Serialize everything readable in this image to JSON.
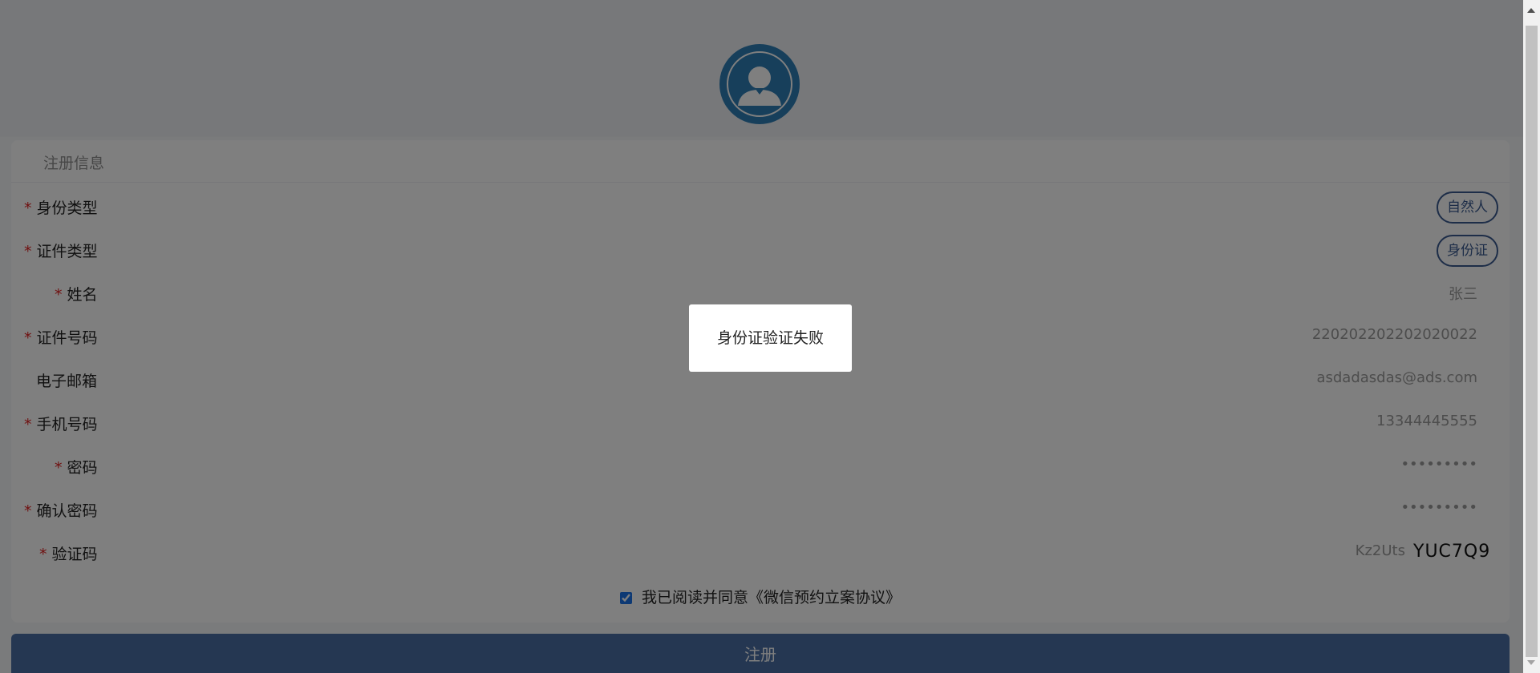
{
  "form": {
    "section_title": "注册信息",
    "fields": [
      {
        "key": "identity_type",
        "label": "身份类型",
        "required": true,
        "value": "自然人",
        "kind": "pill"
      },
      {
        "key": "cert_type",
        "label": "证件类型",
        "required": true,
        "value": "身份证",
        "kind": "pill"
      },
      {
        "key": "name",
        "label": "姓名",
        "required": true,
        "value": "张三",
        "kind": "text"
      },
      {
        "key": "cert_number",
        "label": "证件号码",
        "required": true,
        "value": "220202202202020022",
        "kind": "text"
      },
      {
        "key": "email",
        "label": "电子邮箱",
        "required": false,
        "value": "asdadasdas@ads.com",
        "kind": "text"
      },
      {
        "key": "phone",
        "label": "手机号码",
        "required": true,
        "value": "13344445555",
        "kind": "text"
      },
      {
        "key": "password",
        "label": "密码",
        "required": true,
        "value": "•••••••••",
        "kind": "password"
      },
      {
        "key": "confirm_password",
        "label": "确认密码",
        "required": true,
        "value": "•••••••••",
        "kind": "password"
      },
      {
        "key": "captcha",
        "label": "验证码",
        "required": true,
        "value": "Kz2Uts",
        "captcha_image_text": "YUC7Q9",
        "kind": "captcha"
      }
    ],
    "agreement_text": "我已阅读并同意《微信预约立案协议》",
    "agreement_checked": true,
    "submit_label": "注册"
  },
  "toast": {
    "message": "身份证验证失败"
  },
  "colors": {
    "avatar": "#2f7fb6",
    "primary_button": "#4a6fa5",
    "pill_border": "#3b5b90",
    "required_mark": "#e02020",
    "overlay": "rgba(0,0,0,0.5)"
  },
  "icons": {
    "avatar": "user-avatar-icon"
  }
}
